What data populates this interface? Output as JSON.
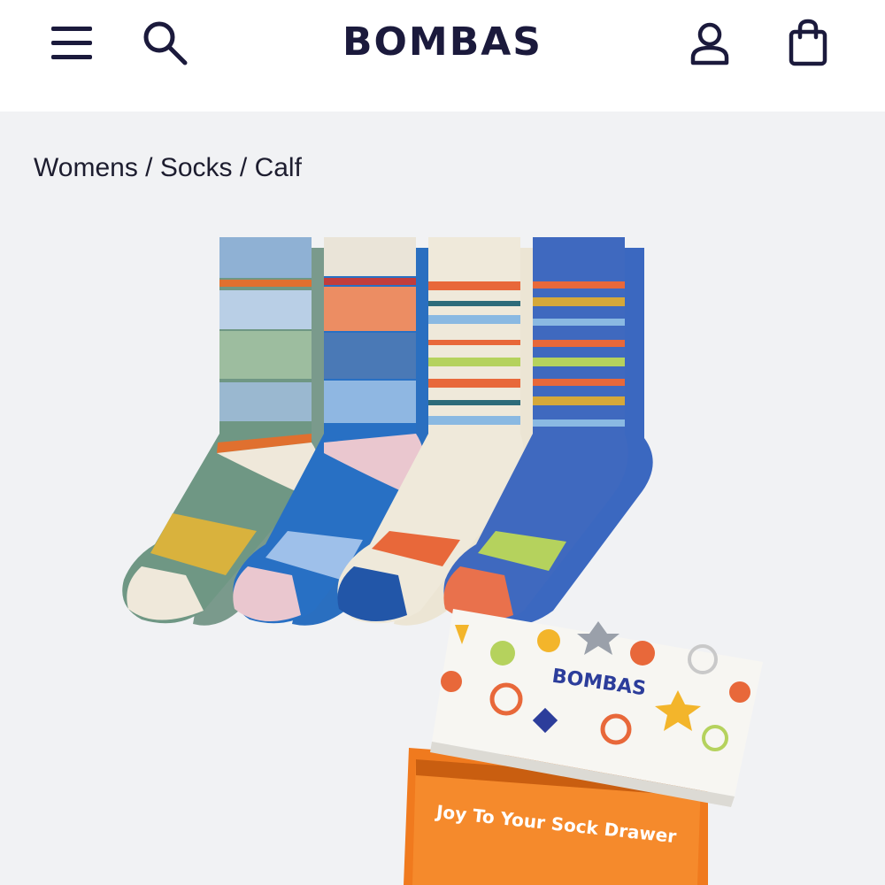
{
  "header": {
    "brand": "BOMBAS",
    "icons": {
      "menu": "hamburger-menu-icon",
      "search": "search-icon",
      "account": "account-icon",
      "bag": "shopping-bag-icon"
    }
  },
  "breadcrumb": {
    "items": [
      "Womens",
      "Socks",
      "Calf"
    ],
    "separator": " / "
  },
  "product": {
    "box_brand": "BOMBAS",
    "box_tagline": "Joy To Your Sock Drawer"
  },
  "colors": {
    "brand_navy": "#1b1a3c",
    "page_bg": "#f1f2f4",
    "box_orange": "#f07a1e"
  }
}
